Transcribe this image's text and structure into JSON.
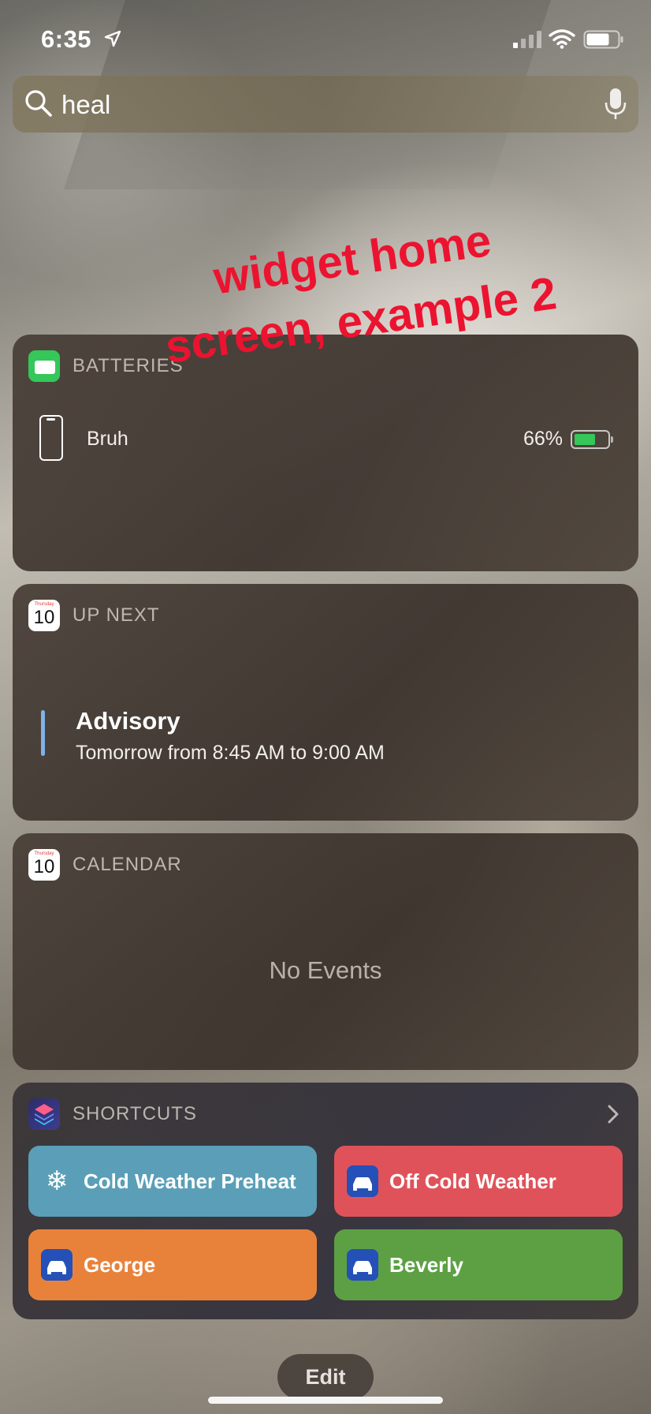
{
  "status_bar": {
    "time": "6:35"
  },
  "search": {
    "query": "heal"
  },
  "annotation": {
    "line1": "widget home",
    "line2": "screen, example 2"
  },
  "widgets": {
    "batteries": {
      "title": "BATTERIES",
      "device_name": "Bruh",
      "percent_text": "66%",
      "level": 0.66
    },
    "up_next": {
      "title": "UP NEXT",
      "icon_day": "Thursday",
      "icon_date": "10",
      "event_title": "Advisory",
      "event_time": "Tomorrow from 8:45 AM to 9:00 AM"
    },
    "calendar": {
      "title": "CALENDAR",
      "icon_day": "Thursday",
      "icon_date": "10",
      "empty_text": "No Events"
    },
    "shortcuts": {
      "title": "SHORTCUTS",
      "buttons": [
        {
          "label": "Cold Weather Preheat",
          "icon": "snowflake-icon",
          "color": "#5a9fb7"
        },
        {
          "label": "Off Cold Weather",
          "icon": "car-icon",
          "color": "#e0525a"
        },
        {
          "label": "George",
          "icon": "car-icon",
          "color": "#e8823b"
        },
        {
          "label": "Beverly",
          "icon": "car-icon",
          "color": "#5da043"
        }
      ]
    }
  },
  "footer": {
    "edit_label": "Edit"
  },
  "colors": {
    "annotation": "#ec1330",
    "battery_green": "#35c759",
    "event_bar": "#7fb2ea"
  }
}
